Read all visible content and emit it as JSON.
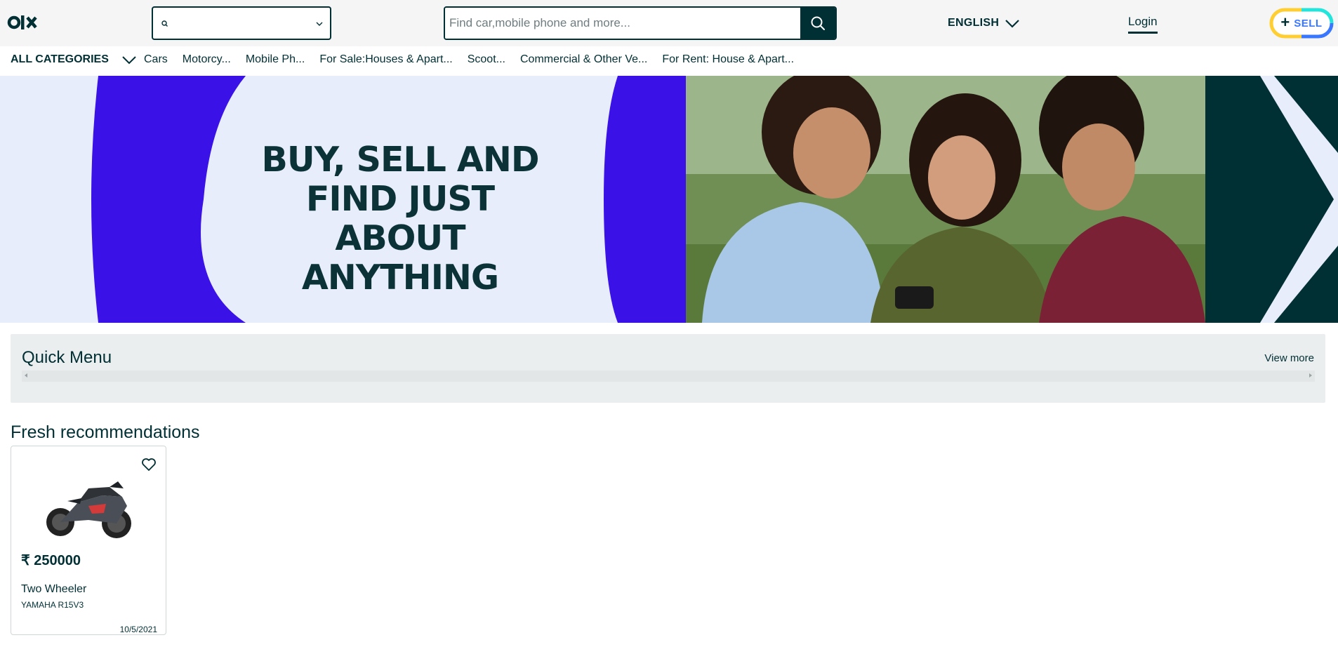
{
  "header": {
    "location_value": "",
    "search_placeholder": "Find car,mobile phone and more...",
    "language_label": "ENGLISH",
    "login_label": "Login",
    "sell_plus": "+",
    "sell_label": "SELL"
  },
  "categories": {
    "all_label": "ALL CATEGORIES",
    "items": [
      "Cars",
      "Motorcy...",
      "Mobile Ph...",
      "For Sale:Houses & Apart...",
      "Scoot...",
      "Commercial & Other Ve...",
      "For Rent: House & Apart..."
    ]
  },
  "banner": {
    "line1": "BUY, SELL AND",
    "line2": "FIND JUST ABOUT",
    "line3": "ANYTHING"
  },
  "quick_menu": {
    "title": "Quick Menu",
    "view_more": "View more"
  },
  "fresh": {
    "title": "Fresh recommendations",
    "cards": [
      {
        "price": "₹ 250000",
        "title": "Two Wheeler",
        "subtitle": "YAMAHA R15V3",
        "date": "10/5/2021"
      }
    ]
  },
  "colors": {
    "brand_dark": "#002f34",
    "banner_purple": "#3a12e8",
    "banner_light": "#e7edfb",
    "sell_yellow": "#ffce32",
    "sell_teal": "#23e5db",
    "sell_blue": "#3a77ff"
  }
}
